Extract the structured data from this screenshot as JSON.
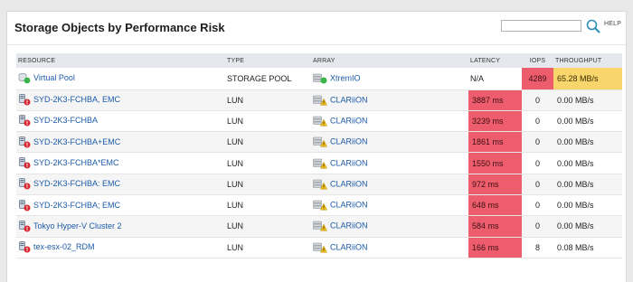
{
  "panel": {
    "title": "Storage Objects by Performance Risk",
    "search_placeholder": "",
    "help_label": "HELP"
  },
  "columns": {
    "resource": "RESOURCE",
    "type": "TYPE",
    "array": "ARRAY",
    "latency": "LATENCY",
    "iops": "IOPS",
    "throughput": "THROUGHPUT"
  },
  "rows": [
    {
      "resource": "Virtual Pool",
      "type": "STORAGE POOL",
      "array": "XtremIO",
      "latency": "N/A",
      "iops": "4289",
      "throughput": "65.28 MB/s",
      "resource_icon": "pool-up-icon",
      "array_icon": "array-up-icon"
    },
    {
      "resource": "SYD-2K3-FCHBA, EMC",
      "type": "LUN",
      "array": "CLARiiON",
      "latency": "3887 ms",
      "iops": "0",
      "throughput": "0.00 MB/s",
      "resource_icon": "lun-critical-icon",
      "array_icon": "array-warning-icon"
    },
    {
      "resource": "SYD-2K3-FCHBA",
      "type": "LUN",
      "array": "CLARiiON",
      "latency": "3239 ms",
      "iops": "0",
      "throughput": "0.00 MB/s",
      "resource_icon": "lun-critical-icon",
      "array_icon": "array-warning-icon"
    },
    {
      "resource": "SYD-2K3-FCHBA+EMC",
      "type": "LUN",
      "array": "CLARiiON",
      "latency": "1861 ms",
      "iops": "0",
      "throughput": "0.00 MB/s",
      "resource_icon": "lun-critical-icon",
      "array_icon": "array-warning-icon"
    },
    {
      "resource": "SYD-2K3-FCHBA*EMC",
      "type": "LUN",
      "array": "CLARiiON",
      "latency": "1550 ms",
      "iops": "0",
      "throughput": "0.00 MB/s",
      "resource_icon": "lun-critical-icon",
      "array_icon": "array-warning-icon"
    },
    {
      "resource": "SYD-2K3-FCHBA: EMC",
      "type": "LUN",
      "array": "CLARiiON",
      "latency": "972 ms",
      "iops": "0",
      "throughput": "0.00 MB/s",
      "resource_icon": "lun-critical-icon",
      "array_icon": "array-warning-icon"
    },
    {
      "resource": "SYD-2K3-FCHBA; EMC",
      "type": "LUN",
      "array": "CLARiiON",
      "latency": "648 ms",
      "iops": "0",
      "throughput": "0.00 MB/s",
      "resource_icon": "lun-critical-icon",
      "array_icon": "array-warning-icon"
    },
    {
      "resource": "Tokyo Hyper-V Cluster 2",
      "type": "LUN",
      "array": "CLARiiON",
      "latency": "584 ms",
      "iops": "0",
      "throughput": "0.00 MB/s",
      "resource_icon": "lun-critical-icon",
      "array_icon": "array-warning-icon"
    },
    {
      "resource": "tex-esx-02_RDM",
      "type": "LUN",
      "array": "CLARiiON",
      "latency": "166 ms",
      "iops": "8",
      "throughput": "0.08 MB/s",
      "resource_icon": "lun-critical-icon",
      "array_icon": "array-warning-icon"
    }
  ],
  "colors": {
    "critical": "#ee5d6d",
    "warning": "#f9d66b",
    "link": "#1b5aa8",
    "header_bg": "#e5e9ed",
    "status_up": "#3bb54a"
  }
}
